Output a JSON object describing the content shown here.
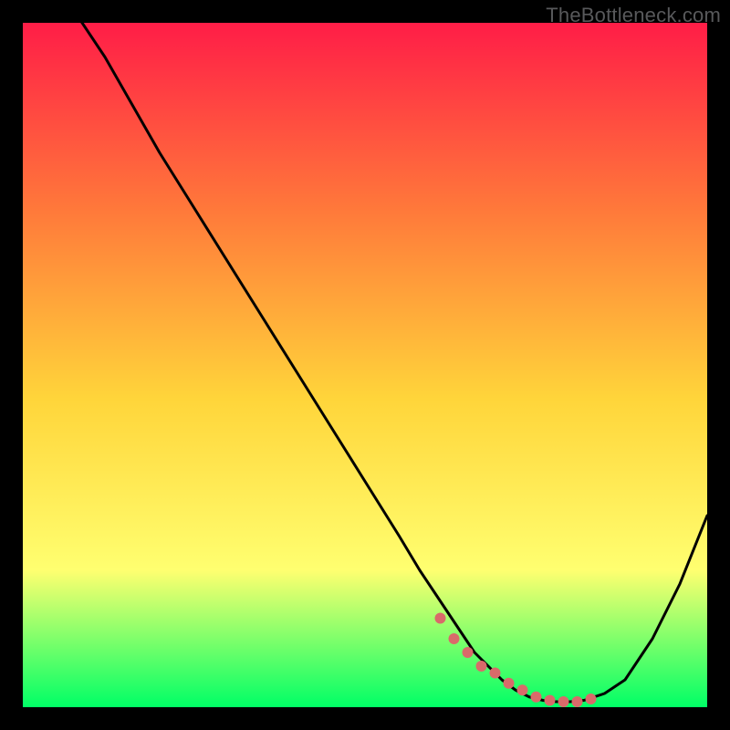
{
  "watermark": "TheBottleneck.com",
  "colors": {
    "frame_bg": "#000000",
    "grad_top": "#ff1d47",
    "grad_mid1": "#ff7b3a",
    "grad_mid2": "#ffd53a",
    "grad_mid3": "#ffff70",
    "grad_bottom": "#00ff66",
    "curve_stroke": "#000000",
    "marker_fill": "#d96a6a"
  },
  "chart_data": {
    "type": "line",
    "title": "",
    "xlabel": "",
    "ylabel": "",
    "xlim": [
      0,
      100
    ],
    "ylim": [
      0,
      100
    ],
    "series": [
      {
        "name": "bottleneck-curve",
        "x": [
          0,
          4,
          8,
          12,
          16,
          20,
          25,
          30,
          35,
          40,
          45,
          50,
          55,
          58,
          60,
          62,
          64,
          66,
          68,
          70,
          72,
          74,
          76,
          78,
          80,
          82,
          85,
          88,
          92,
          96,
          100
        ],
        "values": [
          118,
          106,
          101,
          95,
          88,
          81,
          73,
          65,
          57,
          49,
          41,
          33,
          25,
          20,
          17,
          14,
          11,
          8,
          6,
          4,
          2.5,
          1.5,
          1,
          0.8,
          0.8,
          1,
          2,
          4,
          10,
          18,
          28
        ]
      }
    ],
    "markers": {
      "name": "highlight-points",
      "x": [
        61,
        63,
        65,
        67,
        69,
        71,
        73,
        75,
        77,
        79,
        81,
        83
      ],
      "values": [
        13,
        10,
        8,
        6,
        5,
        3.5,
        2.5,
        1.5,
        1,
        0.8,
        0.8,
        1.2
      ]
    }
  }
}
